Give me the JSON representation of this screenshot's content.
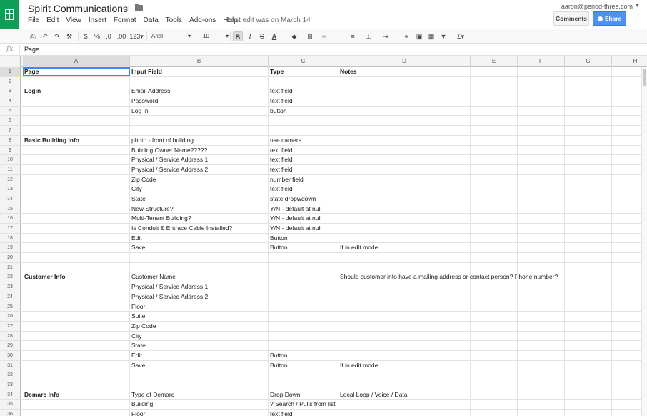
{
  "app": {
    "title": "Spirit Communications",
    "last_edit": "Last edit was on March 14",
    "account": "aaron@period-three.com",
    "comments_label": "Comments",
    "share_label": "Share",
    "brand_color": "#0f9d58",
    "share_color": "#4d90fe"
  },
  "menu": [
    "File",
    "Edit",
    "View",
    "Insert",
    "Format",
    "Data",
    "Tools",
    "Add-ons",
    "Help"
  ],
  "toolbar": {
    "currency": "$",
    "percent": "%",
    "dec_decrease": ".0",
    "dec_increase": ".00",
    "more_formats": "123",
    "font": "Arial",
    "font_size": "10",
    "bold": "B",
    "italic": "I",
    "strike": "S",
    "text_color": "A",
    "functions": "Σ"
  },
  "formula": {
    "fx": "fx",
    "value": "Page"
  },
  "columns": [
    "A",
    "B",
    "C",
    "D",
    "E",
    "F",
    "G",
    "H"
  ],
  "rows": [
    {
      "num": "1",
      "a": "Page",
      "b": "Input Field",
      "c": "Type",
      "d": "Notes",
      "header": true
    },
    {
      "num": "2",
      "a": "",
      "b": "",
      "c": "",
      "d": ""
    },
    {
      "num": "3",
      "a": "Login",
      "b": "Email Address",
      "c": "text field",
      "d": "",
      "section": true
    },
    {
      "num": "4",
      "a": "",
      "b": "Password",
      "c": "text field",
      "d": ""
    },
    {
      "num": "5",
      "a": "",
      "b": "Log In",
      "c": "button",
      "d": ""
    },
    {
      "num": "6",
      "a": "",
      "b": "",
      "c": "",
      "d": ""
    },
    {
      "num": "7",
      "a": "",
      "b": "",
      "c": "",
      "d": ""
    },
    {
      "num": "8",
      "a": "Basic Building Info",
      "b": "photo - front of building",
      "c": "use camera",
      "d": "",
      "section": true
    },
    {
      "num": "9",
      "a": "",
      "b": "Building Owner Name?????",
      "c": "text field",
      "d": ""
    },
    {
      "num": "10",
      "a": "",
      "b": "Physical / Service Address 1",
      "c": "text field",
      "d": ""
    },
    {
      "num": "11",
      "a": "",
      "b": "Physical / Service Address 2",
      "c": "text field",
      "d": ""
    },
    {
      "num": "12",
      "a": "",
      "b": "Zip Code",
      "c": "number field",
      "d": ""
    },
    {
      "num": "13",
      "a": "",
      "b": "City",
      "c": "text field",
      "d": ""
    },
    {
      "num": "14",
      "a": "",
      "b": "State",
      "c": "state dropwdown",
      "d": ""
    },
    {
      "num": "15",
      "a": "",
      "b": "New Structure?",
      "c": "Y/N - default at null",
      "d": ""
    },
    {
      "num": "16",
      "a": "",
      "b": "Multi-Tenant Building?",
      "c": "Y/N - default at null",
      "d": ""
    },
    {
      "num": "17",
      "a": "",
      "b": "Is Conduit & Entrace Cable Installed?",
      "c": "Y/N - default at null",
      "d": ""
    },
    {
      "num": "18",
      "a": "",
      "b": "Edit",
      "c": "Button",
      "d": ""
    },
    {
      "num": "19",
      "a": "",
      "b": "Save",
      "c": "Button",
      "d": "If in edit mode"
    },
    {
      "num": "20",
      "a": "",
      "b": "",
      "c": "",
      "d": ""
    },
    {
      "num": "21",
      "a": "",
      "b": "",
      "c": "",
      "d": ""
    },
    {
      "num": "22",
      "a": "Customer Info",
      "b": "Customer Name",
      "c": "",
      "d": "Should customer info have a mailing address or contact person? Phone number?",
      "section": true
    },
    {
      "num": "23",
      "a": "",
      "b": "Physical / Service Address 1",
      "c": "",
      "d": ""
    },
    {
      "num": "24",
      "a": "",
      "b": "Physical / Service Address 2",
      "c": "",
      "d": ""
    },
    {
      "num": "25",
      "a": "",
      "b": "Floor",
      "c": "",
      "d": ""
    },
    {
      "num": "26",
      "a": "",
      "b": "Suite",
      "c": "",
      "d": ""
    },
    {
      "num": "27",
      "a": "",
      "b": "Zip Code",
      "c": "",
      "d": ""
    },
    {
      "num": "28",
      "a": "",
      "b": "City",
      "c": "",
      "d": ""
    },
    {
      "num": "29",
      "a": "",
      "b": "State",
      "c": "",
      "d": ""
    },
    {
      "num": "30",
      "a": "",
      "b": "Edit",
      "c": "Button",
      "d": ""
    },
    {
      "num": "31",
      "a": "",
      "b": "Save",
      "c": "Button",
      "d": "If in edit mode"
    },
    {
      "num": "32",
      "a": "",
      "b": "",
      "c": "",
      "d": ""
    },
    {
      "num": "33",
      "a": "",
      "b": "",
      "c": "",
      "d": ""
    },
    {
      "num": "34",
      "a": "Demarc Info",
      "b": "Type of Demarc",
      "c": "Drop Down",
      "d": "Local Loop / Voice / Data",
      "section": true
    },
    {
      "num": "35",
      "a": "",
      "b": "Building",
      "c": "? Search / Pulls from list",
      "d": ""
    },
    {
      "num": "36",
      "a": "",
      "b": "Floor",
      "c": "text field",
      "d": ""
    }
  ]
}
